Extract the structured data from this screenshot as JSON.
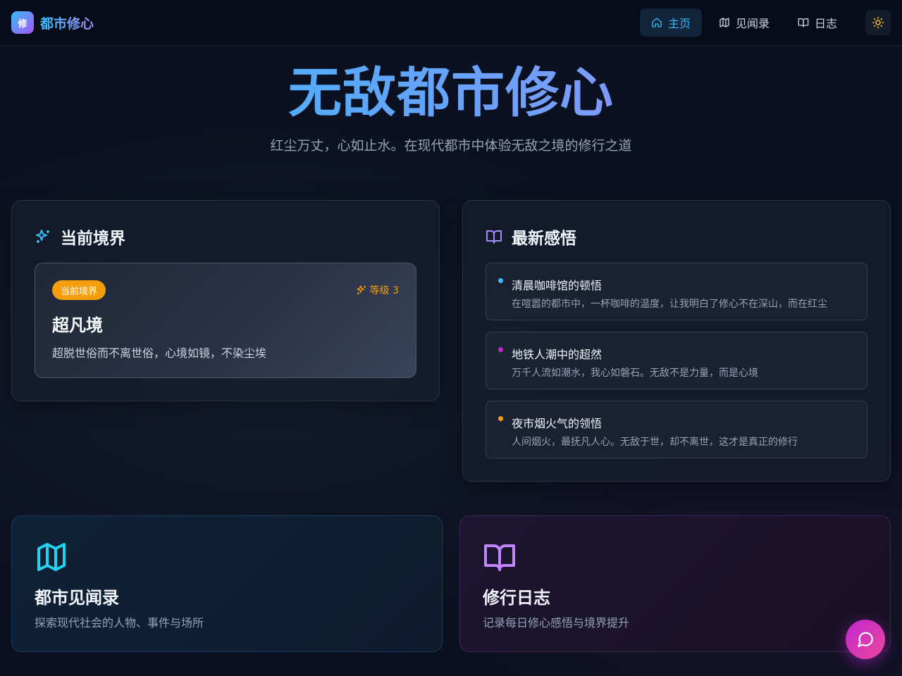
{
  "brand": {
    "logo_text": "修",
    "name": "都市修心"
  },
  "nav": {
    "home": "主页",
    "explore": "见闻录",
    "journal": "日志"
  },
  "hero": {
    "title": "无敌都市修心",
    "subtitle": "红尘万丈，心如止水。在现代都市中体验无敌之境的修行之道"
  },
  "realm_panel": {
    "heading": "当前境界",
    "badge": "当前境界",
    "level": "等级 3",
    "name": "超凡境",
    "description": "超脱世俗而不离世俗，心境如镜，不染尘埃"
  },
  "insight_panel": {
    "heading": "最新感悟",
    "items": [
      {
        "title": "清晨咖啡馆的顿悟",
        "text": "在喧嚣的都市中，一杯咖啡的温度，让我明白了修心不在深山，而在红尘",
        "dot_color": "#38bdf8"
      },
      {
        "title": "地铁人潮中的超然",
        "text": "万千人流如潮水，我心如磐石。无敌不是力量，而是心境",
        "dot_color": "#c026d3"
      },
      {
        "title": "夜市烟火气的领悟",
        "text": "人间烟火，最抚凡人心。无敌于世，却不离世，这才是真正的修行",
        "dot_color": "#f59e0b"
      }
    ]
  },
  "features": {
    "explore": {
      "title": "都市见闻录",
      "desc": "探索现代社会的人物、事件与场所"
    },
    "journal": {
      "title": "修行日志",
      "desc": "记录每日修心感悟与境界提升"
    }
  },
  "colors": {
    "accent_blue": "#38bdf8",
    "accent_purple": "#a855f7",
    "accent_amber": "#f59e0b"
  },
  "icons": {
    "home": "home-icon",
    "map": "map-icon",
    "book": "book-open-icon",
    "sun": "sun-icon",
    "sparkles": "sparkles-icon",
    "chat": "message-circle-icon"
  }
}
